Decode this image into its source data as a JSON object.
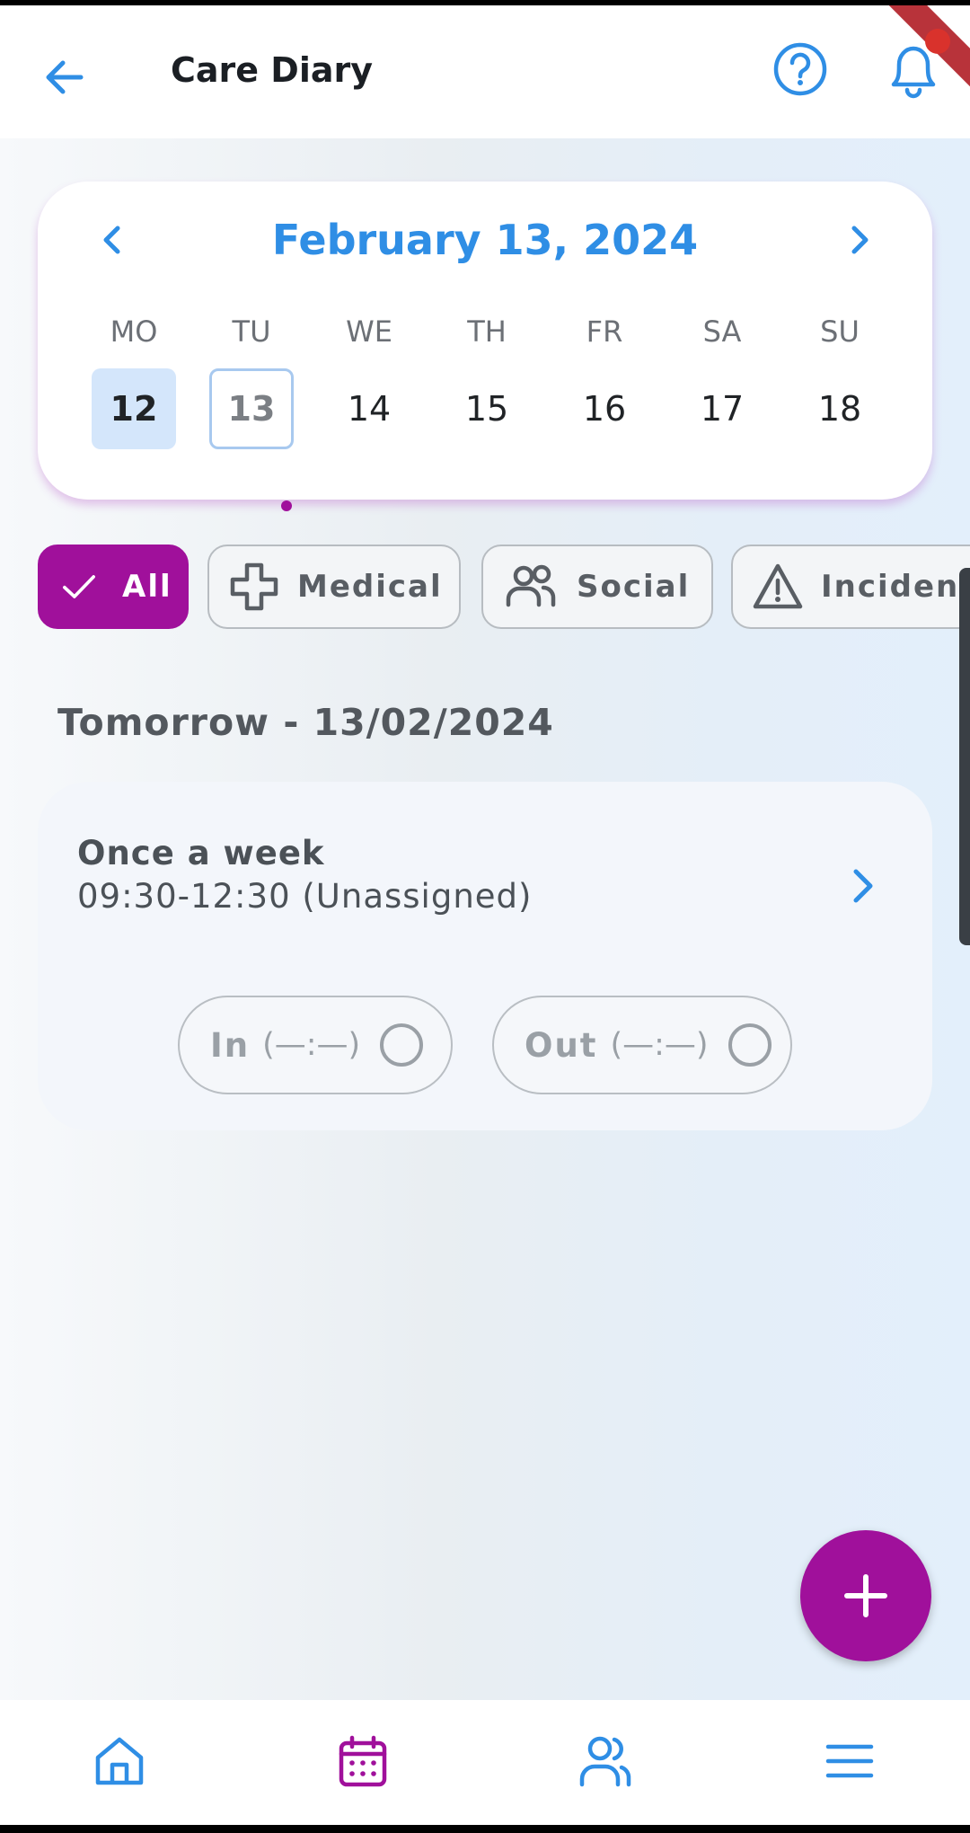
{
  "header": {
    "title": "Care Diary"
  },
  "calendar": {
    "month_label": "February 13, 2024",
    "weekdays": [
      "MO",
      "TU",
      "WE",
      "TH",
      "FR",
      "SA",
      "SU"
    ],
    "days": [
      "12",
      "13",
      "14",
      "15",
      "16",
      "17",
      "18"
    ],
    "selected_day": "12",
    "today_day": "13"
  },
  "filters": [
    {
      "label": "All",
      "icon": "check-icon",
      "active": true
    },
    {
      "label": "Medical",
      "icon": "plus-cross-icon",
      "active": false
    },
    {
      "label": "Social",
      "icon": "people-icon",
      "active": false
    },
    {
      "label": "Incident",
      "icon": "warning-icon",
      "active": false
    }
  ],
  "section": {
    "heading": "Tomorrow - 13/02/2024"
  },
  "visit": {
    "title": "Once a week",
    "time": "09:30-12:30 (Unassigned)",
    "clock_in_label": "In",
    "clock_in_time": "(—:—)",
    "clock_out_label": "Out",
    "clock_out_time": "(—:—)"
  },
  "bottom_nav": [
    {
      "icon": "home-icon"
    },
    {
      "icon": "calendar-icon",
      "active": true
    },
    {
      "icon": "users-icon"
    },
    {
      "icon": "menu-icon"
    }
  ],
  "colors": {
    "accent_blue": "#2f8ee5",
    "accent_purple": "#a0109b",
    "text_dark": "#1b1f24"
  }
}
